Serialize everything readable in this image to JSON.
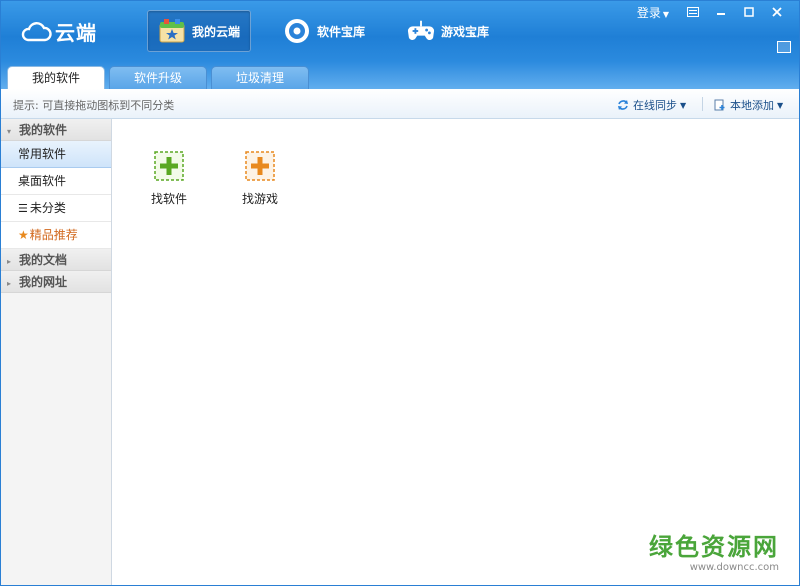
{
  "app": {
    "logo_text": "云端"
  },
  "nav": [
    {
      "label": "我的云端"
    },
    {
      "label": "软件宝库"
    },
    {
      "label": "游戏宝库"
    }
  ],
  "window_controls": {
    "login": "登录"
  },
  "tabs": [
    {
      "label": "我的软件"
    },
    {
      "label": "软件升级"
    },
    {
      "label": "垃圾清理"
    }
  ],
  "hintbar": {
    "hint": "提示: 可直接拖动图标到不同分类",
    "sync_label": "在线同步",
    "local_add_label": "本地添加"
  },
  "sidebar": {
    "group_software": "我的软件",
    "items": [
      {
        "label": "常用软件"
      },
      {
        "label": "桌面软件"
      },
      {
        "label": "未分类"
      },
      {
        "label": "精品推荐"
      }
    ],
    "group_documents": "我的文档",
    "group_websites": "我的网址"
  },
  "content": {
    "tiles": [
      {
        "label": "找软件",
        "color": "#5aa823"
      },
      {
        "label": "找游戏",
        "color": "#e8891e"
      }
    ]
  },
  "watermark": {
    "main": "绿色资源网",
    "sub": "www.downcc.com"
  },
  "colors": {
    "header": "#1f7fd6",
    "accent": "#2a7fd4"
  }
}
